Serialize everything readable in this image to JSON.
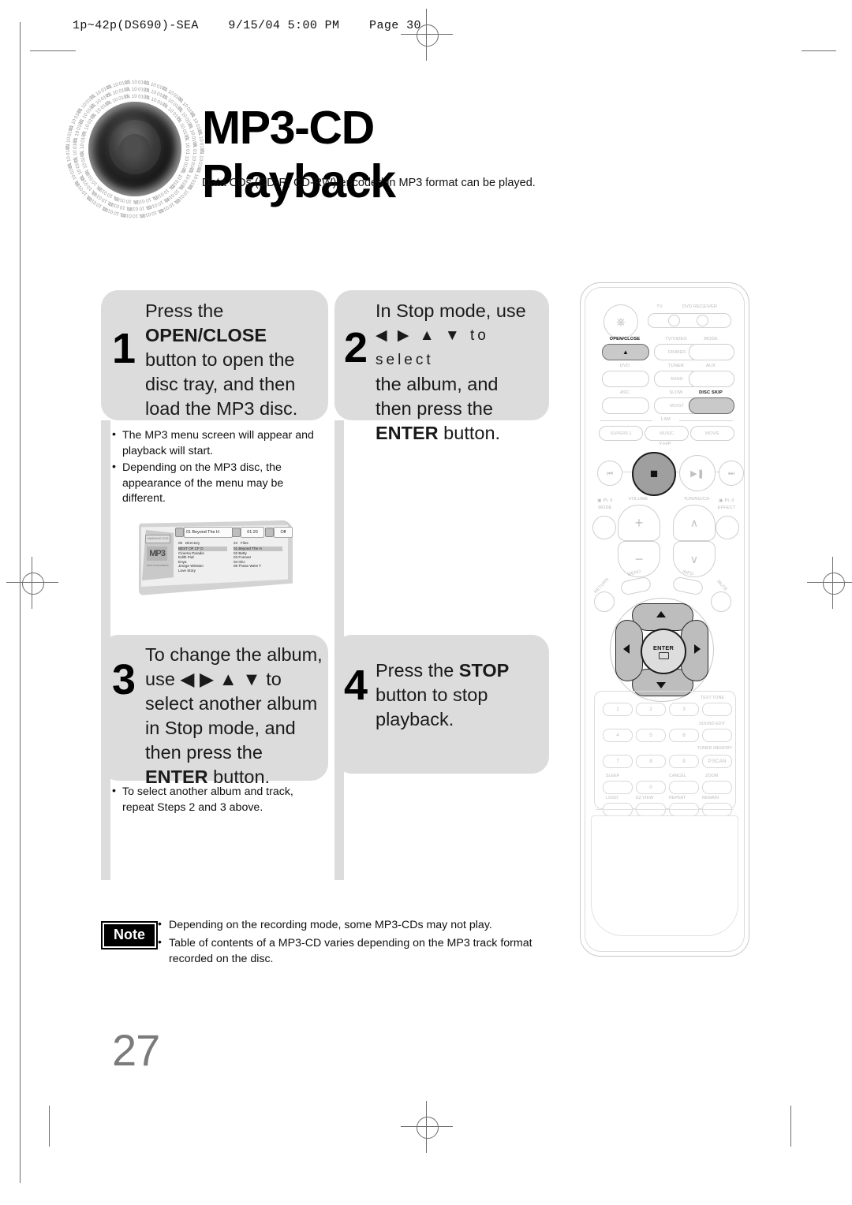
{
  "header": {
    "slug": "1p~42p(DS690)-SEA    9/15/04 5:00 PM    Page 30"
  },
  "title": {
    "heading": "MP3-CD Playback",
    "subtitle": "Data CDs (CD-R, CD-RW) encoded in MP3 format can be played."
  },
  "steps": [
    {
      "number": "1",
      "lines": [
        "Press the",
        "OPEN/CLOSE",
        "button to open the",
        "disc tray, and then",
        "load the MP3 disc."
      ],
      "bold_line_index": 1
    },
    {
      "number": "2",
      "lines": [
        "In Stop mode, use",
        "◀ ▶ ▲ ▼ to select",
        "the album, and",
        "then press the",
        "ENTER button."
      ],
      "bold_line_index": 4
    },
    {
      "number": "3",
      "lines": [
        "To change the album,",
        "use ◀ ▶ ▲ ▼  to",
        "select another album",
        "in Stop mode, and",
        "then press the",
        "ENTER button."
      ],
      "bold_line_index": 5
    },
    {
      "number": "4",
      "lines": [
        "Press the STOP",
        "button to stop",
        "playback."
      ],
      "bold_line_index": 0
    }
  ],
  "bullets_step1": [
    "The MP3 menu screen will appear and playback will start.",
    "Depending on the MP3 disc, the appearance of the menu may be different."
  ],
  "bullets_step3": [
    "To select another album and track, repeat Steps 2 and 3 above."
  ],
  "tv_screen": {
    "topbar": {
      "track": "01 Beyond The H",
      "time": "01:20",
      "repeat": "Off"
    },
    "left_panel": {
      "brand": "SAMSUNG DVD",
      "logo": "MP3",
      "logo_sub": "DIGITAL AUDIO",
      "tagline": "DISC IN PLAYBACK"
    },
    "directory": {
      "count": "05",
      "header": "Directory",
      "items": [
        "BEST OF CF D",
        "Cinema Paradis",
        "Edith Piaf",
        "Enya",
        "Jeorge Winston",
        "Love Story"
      ],
      "selected_index": 0
    },
    "files": {
      "count": "22",
      "header": "Files",
      "items": [
        "01 Beyond The H",
        "02 Betty",
        "03 Forever",
        "04 IOU",
        "05 Those Were T"
      ],
      "selected_index": 0
    }
  },
  "note": {
    "badge": "Note",
    "items": [
      "Depending on the recording mode, some MP3-CDs may not play.",
      "Table of contents of a MP3-CD varies depending on the MP3 track format recorded on the disc."
    ]
  },
  "page_number": "27",
  "remote": {
    "source_switch": {
      "tv": "TV",
      "dvd": "DVD RECEIVER"
    },
    "row_openclose": {
      "open_close": "OPEN/CLOSE",
      "tv_video": "TV/VIDEO",
      "dimmer": "DIMMER",
      "mode": "MODE"
    },
    "row_dvd": {
      "dvd": "DVD",
      "tuner": "TUNER",
      "band": "BAND",
      "aux": "AUX"
    },
    "row_asc": {
      "asc": "ASC",
      "slow": "SLOW",
      "most": "MO/ST",
      "disc_skip": "DISC SKIP"
    },
    "lsm": {
      "label": "LSM",
      "super": "SUPER5.1",
      "music": "MUSIC",
      "movie": "MOVIE",
      "vhp": "V-H/P"
    },
    "transport": {
      "prev": "⏮",
      "stop": "■",
      "play": "▶/❙❙",
      "next": "⏭"
    },
    "volume": {
      "label": "VOLUME",
      "plus": "+",
      "minus": "−"
    },
    "tuning": {
      "label": "TUNING/CH",
      "up": "∧",
      "down": "∨"
    },
    "pl2": {
      "mode_top": "PL II",
      "mode_bottom": "MODE",
      "effect_top": "PL II",
      "effect_bottom": "EFFECT"
    },
    "nav": {
      "return": "RETURN",
      "menu": "MENU",
      "info": "INFO",
      "mute": "MUTE",
      "enter": "ENTER"
    },
    "keypad": {
      "digits": [
        "1",
        "2",
        "3",
        "4",
        "5",
        "6",
        "7",
        "8",
        "9",
        "0"
      ],
      "test_tone": "TEST TONE",
      "sound_edit": "SOUND EDIT",
      "tuner_memory": "TUNER MEMORY",
      "p_scan": "P.SCAN",
      "sleep": "SLEEP",
      "cancel": "CANCEL",
      "zoom": "ZOOM",
      "logo": "LOGO",
      "ez_view": "EZ VIEW",
      "repeat": "REPEAT",
      "remain": "REMAIN"
    }
  },
  "colors": {
    "step_bg": "#dcdcdc",
    "highlight": "#c9c9c9",
    "page_number": "#7b7b7b"
  }
}
